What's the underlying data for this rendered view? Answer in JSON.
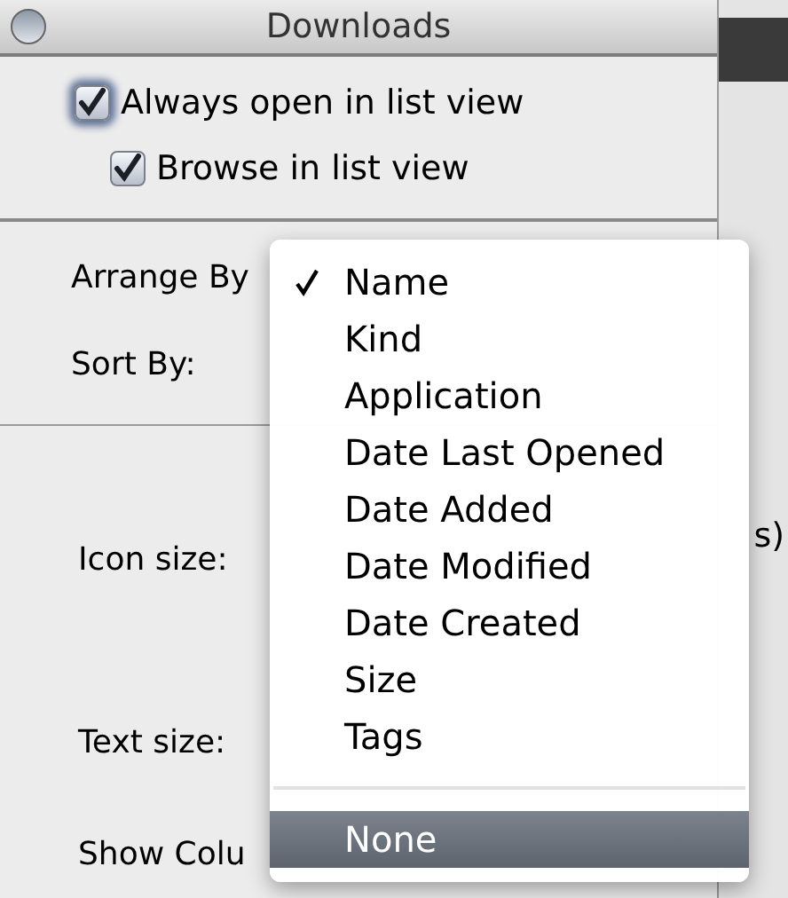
{
  "window": {
    "title": "Downloads"
  },
  "checkboxes": [
    {
      "label": "Always open in list view",
      "checked": true,
      "focused": true
    },
    {
      "label": "Browse in list view",
      "checked": true,
      "focused": false
    }
  ],
  "labels": [
    "Arrange By",
    "Sort By:",
    "Icon size:",
    "Text size:",
    "Show Colu"
  ],
  "background_text": "s)",
  "menu": {
    "items": [
      {
        "label": "Name",
        "checked": true,
        "selected": false
      },
      {
        "label": "Kind",
        "checked": false,
        "selected": false
      },
      {
        "label": "Application",
        "checked": false,
        "selected": false
      },
      {
        "label": "Date Last Opened",
        "checked": false,
        "selected": false
      },
      {
        "label": "Date Added",
        "checked": false,
        "selected": false
      },
      {
        "label": "Date Modified",
        "checked": false,
        "selected": false
      },
      {
        "label": "Date Created",
        "checked": false,
        "selected": false
      },
      {
        "label": "Size",
        "checked": false,
        "selected": false
      },
      {
        "label": "Tags",
        "checked": false,
        "selected": false
      }
    ],
    "footer_items": [
      {
        "label": "None",
        "checked": false,
        "selected": true
      }
    ]
  }
}
